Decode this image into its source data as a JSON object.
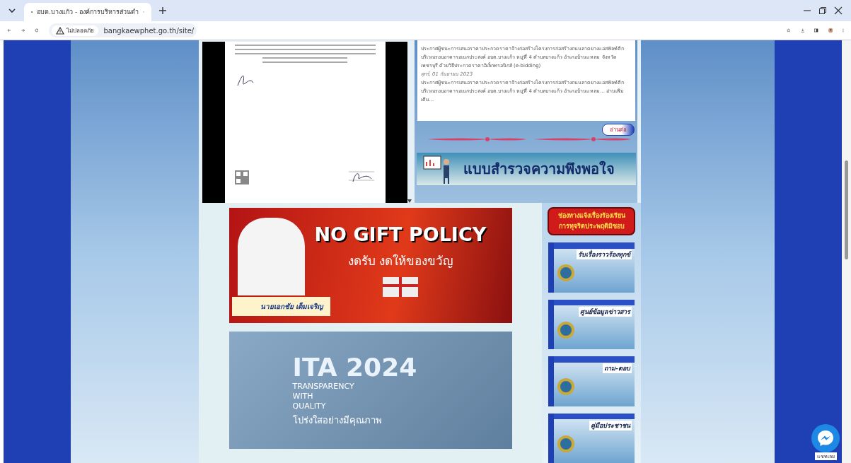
{
  "browser": {
    "tab_title": "อบต.บางแก้ว - องค์การบริหารส่วนตำ",
    "security_label": "ไม่ปลอดภัย",
    "url": "bangkaewphet.go.th/site/"
  },
  "news": {
    "paragraphs": [
      {
        "kind": "body",
        "text": "ประกาศผู้ชนะการเสนอราคาประกวดราคาจ้างก่อสร้างโครงการก่อสร้างถนนลาดยางแอสฟัลท์ติก บริเวณรอบอาคารอเนกประสงค์ อบต.บางแก้ว หมู่ที่ 4 ตำบลบางแก้ว อำเภอบ้านแหลม จังหวัดเพชรบุรี ด้วยวิธีประกวดราคาอิเล็กทรอนิกส์ (e-bidding)"
      },
      {
        "kind": "date",
        "text": "ศุกร์, 01 กันยายน 2023"
      },
      {
        "kind": "body",
        "text": "ประกาศผู้ชนะการเสนอราคาประกวดราคาจ้างก่อสร้างโครงการก่อสร้างถนนลาดยางแอสฟัลท์ติก บริเวณรอบอาคารอเนกประสงค์ อบต.บางแก้ว หมู่ที่ 4 ตำบลบางแก้ว อำเภอบ้านแหลม... อ่านเพิ่มเติม..."
      }
    ],
    "read_more": "อ่านต่อ"
  },
  "survey_banner": "แบบสำรวจความพึงพอใจ",
  "gift_banner": {
    "title": "NO GIFT POLICY",
    "subtitle": "งดรับ งดให้ของขวัญ",
    "name": "นายเอกชัย เต็มเจริญ"
  },
  "ita_banner": {
    "title": "ITA 2024",
    "lines": [
      "TRANSPARENCY",
      "WITH",
      "QUALITY"
    ],
    "thai": "โปร่งใสอย่างมีคุณภาพ"
  },
  "complaint_button": [
    "ช่องทางแจ้งเรื่องร้องเรียน",
    "การทุจริตประพฤติมิชอบ"
  ],
  "side_banners": [
    "รับเรื่องราวร้องทุกข์",
    "ศูนย์ข้อมูลข่าวสาร",
    "ถาม-ตอบ",
    "คู่มือประชาชน"
  ],
  "chat_label": "แชทเลย"
}
